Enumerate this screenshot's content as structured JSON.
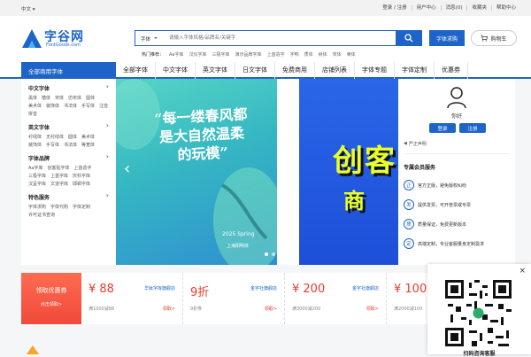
{
  "topbar": {
    "lang": "中文",
    "links": [
      "登录 / 注册",
      "用户中心",
      "消息(0)",
      "收藏夹",
      "帮助中心"
    ]
  },
  "logo": {
    "name": "字谷网",
    "sub": "FontGoods.com"
  },
  "search": {
    "category": "字体",
    "placeholder": "请输入字体风格/品牌名/关键字"
  },
  "hot": {
    "label": "热门推荐：",
    "items": [
      "Aa字库",
      "汉仪字库",
      "三极字库",
      "演示品牌字库",
      "上首造字",
      "字鸭",
      "质体",
      "树体",
      "宋体",
      "柬体"
    ]
  },
  "header_buttons": {
    "request": "字体求购",
    "cart": "购物车"
  },
  "nav": {
    "all": "全部商用字体",
    "items": [
      "全部字体",
      "中文字体",
      "英文字体",
      "日文字体",
      "免费商用",
      "店铺列表",
      "字体专题",
      "字体定制",
      "优惠券"
    ]
  },
  "menu": [
    {
      "title": "中文字体",
      "links": [
        "黑体",
        "楷体",
        "宋体",
        "仿宋体",
        "圆体",
        "美术体",
        "装饰体",
        "书法体",
        "手写体",
        "注音",
        "拼音"
      ]
    },
    {
      "title": "英文字体",
      "links": [
        "衬线体",
        "无衬线体",
        "圆体",
        "美术体",
        "装饰体",
        "手写体",
        "书法体",
        "等宽体"
      ]
    },
    {
      "title": "字体品牌",
      "links": [
        "Aa字库",
        "创客贴字体",
        "上首造字",
        "三极字库",
        "上首字库",
        "庆科字库",
        "汉呈字库",
        "文道字库",
        "邯郸字库"
      ]
    },
    {
      "title": "特色服务",
      "links": [
        "字体求购",
        "字体代购",
        "字体定制",
        "许可证书查询"
      ]
    }
  ],
  "banner1": {
    "headline": "“每一缕春风都是大自然温柔的玩模”",
    "year": "2025",
    "season": "Spring",
    "foot": "上海阳明体"
  },
  "banner2": {
    "line1": "创客",
    "line2": "商"
  },
  "user": {
    "hello": "你好",
    "login": "登录",
    "register": "注册",
    "declare": "严正声明",
    "service_title": "专属会员服务",
    "services": [
      {
        "icon": "正",
        "text": "官方正版，避免版权纠纷"
      },
      {
        "icon": "发",
        "text": "提供发票，可开普票或专票"
      },
      {
        "icon": "质",
        "text": "质量保证，免费更新版本"
      },
      {
        "icon": "定",
        "text": "高端定制，专业客服量身定制需求"
      }
    ]
  },
  "coupons": {
    "lead": {
      "title": "领取优惠券",
      "action": "点击领取>"
    },
    "items": [
      {
        "amount": "¥ 88",
        "shop": "华钛字库旗舰店",
        "cond": "满1000减88",
        "get": "领取>"
      },
      {
        "amount": "9折",
        "shop": "金宇社旗舰店",
        "cond": "9折券",
        "get": "领取>"
      },
      {
        "amount": "¥ 200",
        "shop": "金宇社旗舰店",
        "cond": "满3000减200",
        "get": "领取>"
      },
      {
        "amount": "¥ 100",
        "shop": "",
        "cond": "满2000减100",
        "get": ""
      }
    ]
  },
  "qr": {
    "caption": "扫码咨询客服"
  },
  "colors": {
    "brand": "#1e64c8",
    "accent": "#e83b2c"
  }
}
